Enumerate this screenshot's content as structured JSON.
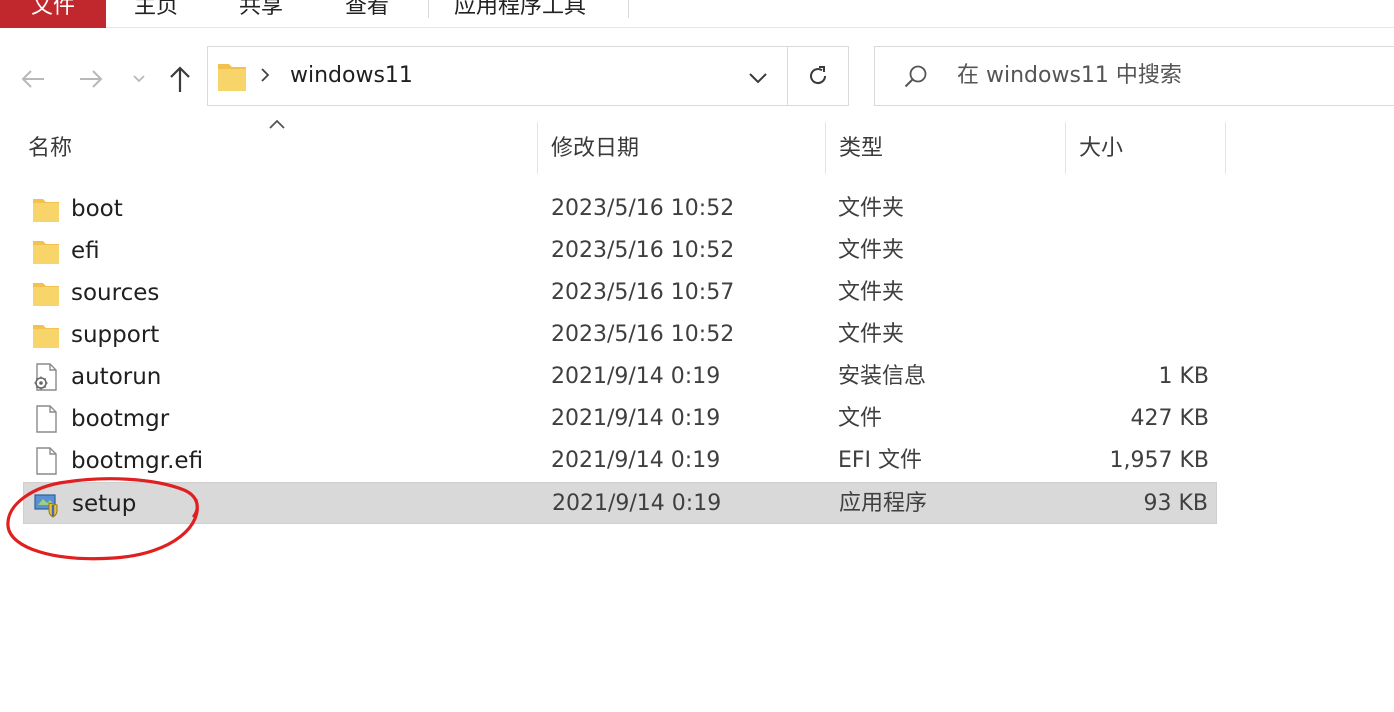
{
  "ribbon": {
    "tabs": [
      {
        "label": "文件",
        "active": true,
        "color": "#c0282d"
      },
      {
        "label": "主页"
      },
      {
        "label": "共享"
      },
      {
        "label": "查看"
      },
      {
        "label": "应用程序工具"
      }
    ]
  },
  "nav": {
    "back_icon": "arrow-left-icon",
    "forward_icon": "arrow-right-icon",
    "recent_icon": "chevron-down-icon",
    "up_icon": "arrow-up-icon"
  },
  "address": {
    "folder_icon": "folder-icon",
    "path": "windows11",
    "refresh_icon": "refresh-icon"
  },
  "search": {
    "icon": "search-icon",
    "placeholder": "在 windows11 中搜索"
  },
  "columns": {
    "name": "名称",
    "date": "修改日期",
    "type": "类型",
    "size": "大小",
    "sorted_by": "名称",
    "sort_direction": "ascending"
  },
  "files": [
    {
      "name": "boot",
      "date": "2023/5/16 10:52",
      "type": "文件夹",
      "size": "",
      "icon": "folder-icon"
    },
    {
      "name": "efi",
      "date": "2023/5/16 10:52",
      "type": "文件夹",
      "size": "",
      "icon": "folder-icon"
    },
    {
      "name": "sources",
      "date": "2023/5/16 10:57",
      "type": "文件夹",
      "size": "",
      "icon": "folder-icon"
    },
    {
      "name": "support",
      "date": "2023/5/16 10:52",
      "type": "文件夹",
      "size": "",
      "icon": "folder-icon"
    },
    {
      "name": "autorun",
      "date": "2021/9/14 0:19",
      "type": "安装信息",
      "size": "1 KB",
      "icon": "settings-file-icon"
    },
    {
      "name": "bootmgr",
      "date": "2021/9/14 0:19",
      "type": "文件",
      "size": "427 KB",
      "icon": "file-icon"
    },
    {
      "name": "bootmgr.efi",
      "date": "2021/9/14 0:19",
      "type": "EFI 文件",
      "size": "1,957 KB",
      "icon": "file-icon"
    },
    {
      "name": "setup",
      "date": "2021/9/14 0:19",
      "type": "应用程序",
      "size": "93 KB",
      "icon": "setup-app-icon",
      "selected": true
    }
  ],
  "annotation": {
    "shape": "ellipse",
    "color": "#e02020",
    "target": "setup"
  }
}
